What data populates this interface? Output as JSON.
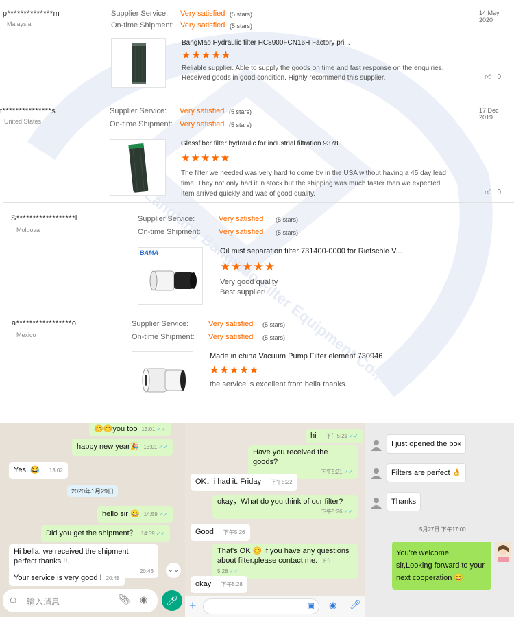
{
  "reviews": [
    {
      "name": "p**************m",
      "country": "Malaysia",
      "service_label": "Supplier Service:",
      "service_value": "Very satisfied",
      "service_stars": "(5 stars)",
      "shipment_label": "On-time Shipment:",
      "shipment_value": "Very satisfied",
      "shipment_stars": "(5 stars)",
      "date": "14 May 2020",
      "product_title": "BangMao Hydraulic filter HC8900FCN16H Factory pri...",
      "rating": 5,
      "stars": "★★★★★",
      "text": "Reliable supplier. Able to supply the goods on time and fast response on the enquiries. Received goods in good condition. Highly recommend this supplier.",
      "likes": "0"
    },
    {
      "name": "t***************s",
      "country": "United States",
      "service_label": "Supplier Service:",
      "service_value": "Very satisfied",
      "service_stars": "(5 stars)",
      "shipment_label": "On-time Shipment:",
      "shipment_value": "Very satisfied",
      "shipment_stars": "(5 stars)",
      "date": "17 Dec 2019",
      "product_title": "Glassfiber filter hydraulic for industrial filtration 9378...",
      "rating": 5,
      "stars": "★★★★★",
      "text": "The filter we needed was very hard to come by in the USA without having a 45 day lead time. They not only had it in stock but the shipping was much faster than we expected. Item arrived quickly and was of good quality.",
      "likes": "0"
    },
    {
      "name": "S******************i",
      "country": "Moldova",
      "service_label": "Supplier Service:",
      "service_value": "Very satisfied",
      "service_stars": "(5 stars)",
      "shipment_label": "On-time Shipment:",
      "shipment_value": "Very satisfied",
      "shipment_stars": "(5 stars)",
      "product_title": "Oil mist separation filter 731400-0000 for Rietschle V...",
      "brand_logo": "BAMA",
      "rating": 5,
      "stars": "★★★★★",
      "text_line1": "Very good quality",
      "text_line2": "Best supplier!"
    },
    {
      "name": "a*****************o",
      "country": "Mexico",
      "service_label": "Supplier Service:",
      "service_value": "Very satisfied",
      "service_stars": "(5 stars)",
      "shipment_label": "On-time Shipment:",
      "shipment_value": "Very satisfied",
      "shipment_stars": "(5 stars)",
      "product_title": "Made in china Vacuum Pump Filter element 730946",
      "rating": 5,
      "stars": "★★★★★",
      "text": "the service is excellent from bella thanks."
    }
  ],
  "watermark_text": "Langfang Bangmao Filter Equipment Co.,",
  "chat_whatsapp": {
    "m1_text": "😊😊you too",
    "m1_time": "13:01",
    "m2_text": "happy new year🎉",
    "m2_time": "13:01",
    "m3_text": "Yes!!😂",
    "m3_time": "13:02",
    "date_chip": "2020年1月29日",
    "m4_text": "hello sir 😀",
    "m4_time": "14:59",
    "m5_text": "Did you get the shipment？",
    "m5_time": "14:59",
    "m6_text": "Hi bella, we received the shipment perfect thanks !!.",
    "m6_time": "20:46",
    "m7_text": "Your service is very good !",
    "m7_time": "20:48",
    "input_placeholder": "输入消息",
    "ticks": "✓✓",
    "scroll_glyph": "⌄⌄"
  },
  "chat_wechat": {
    "m1_text": "hi",
    "m1_time": "下午5:21",
    "m2_text": "Have you received the goods?",
    "m2_time": "下午5:21",
    "m3_text": "OK．i had it. Friday",
    "m3_time": "下午5:22",
    "m4_text": "okay，What do you think of our filter?",
    "m4_time": "下午5:26",
    "m5_text": "Good",
    "m5_time": "下午5:26",
    "m6_text": "That's OK 😊 if you have any questions about filter.please contact me.",
    "m6_time": "下午5:28",
    "m7_text": "okay",
    "m7_time": "下午5:28",
    "ticks": "✓✓"
  },
  "chat_qq": {
    "m1_text": "I just opened the box",
    "m2_text": "Filters are perfect 👌",
    "m3_text": "Thanks",
    "timestamp": "5月27日 下午17:00",
    "m4_text": "You're welcome, sir,Looking forward to your next cooperation 😄"
  },
  "colors": {
    "accent_orange": "#ff6a00",
    "whatsapp_out": "#dcf8c6",
    "whatsapp_green": "#00a884",
    "qq_out": "#9ee35a"
  }
}
